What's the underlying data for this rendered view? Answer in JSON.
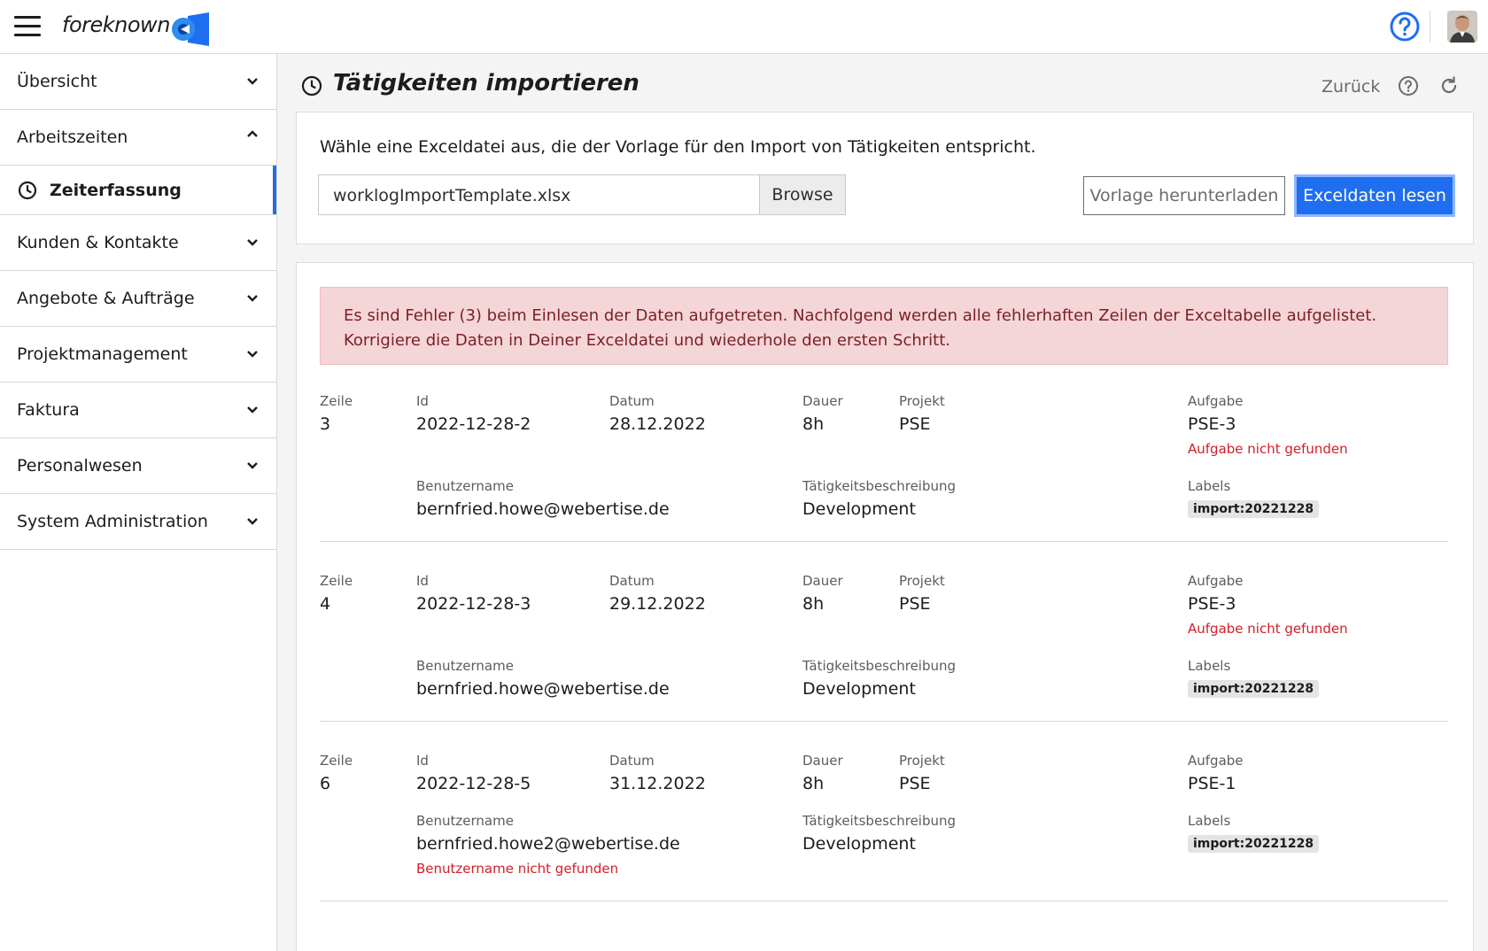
{
  "app": {
    "logo_text": "foreknown"
  },
  "sidebar": {
    "items": [
      {
        "label": "Übersicht",
        "expanded": false
      },
      {
        "label": "Arbeitszeiten",
        "expanded": true
      },
      {
        "label": "Kunden & Kontakte",
        "expanded": false
      },
      {
        "label": "Angebote & Aufträge",
        "expanded": false
      },
      {
        "label": "Projektmanagement",
        "expanded": false
      },
      {
        "label": "Faktura",
        "expanded": false
      },
      {
        "label": "Personalwesen",
        "expanded": false
      },
      {
        "label": "System Administration",
        "expanded": false
      }
    ],
    "sub_item": {
      "label": "Zeiterfassung",
      "active": true
    }
  },
  "page": {
    "title": "Tätigkeiten importieren",
    "back_label": "Zurück"
  },
  "upload": {
    "hint": "Wähle eine Exceldatei aus, die der Vorlage für den Import von Tätigkeiten entspricht.",
    "file_name": "worklogImportTemplate.xlsx",
    "browse_label": "Browse",
    "download_label": "Vorlage herunterladen",
    "read_label": "Exceldaten lesen"
  },
  "results": {
    "alert": "Es sind Fehler (3) beim Einlesen der Daten aufgetreten. Nachfolgend werden alle fehlerhaften Zeilen der Exceltabelle aufgelistet. Korrigiere die Daten in Deiner Exceldatei und wiederhole den ersten Schritt.",
    "labels": {
      "zeile": "Zeile",
      "id": "Id",
      "datum": "Datum",
      "dauer": "Dauer",
      "projekt": "Projekt",
      "aufgabe": "Aufgabe",
      "benutzername": "Benutzername",
      "beschreibung": "Tätigkeitsbeschreibung",
      "labels": "Labels"
    },
    "rows": [
      {
        "zeile": "3",
        "id": "2022-12-28-2",
        "datum": "28.12.2022",
        "dauer": "8h",
        "projekt": "PSE",
        "aufgabe": "PSE-3",
        "aufgabe_error": "Aufgabe nicht gefunden",
        "benutzername": "bernfried.howe@webertise.de",
        "benutzername_error": "",
        "beschreibung": "Development",
        "label": "import:20221228"
      },
      {
        "zeile": "4",
        "id": "2022-12-28-3",
        "datum": "29.12.2022",
        "dauer": "8h",
        "projekt": "PSE",
        "aufgabe": "PSE-3",
        "aufgabe_error": "Aufgabe nicht gefunden",
        "benutzername": "bernfried.howe@webertise.de",
        "benutzername_error": "",
        "beschreibung": "Development",
        "label": "import:20221228"
      },
      {
        "zeile": "6",
        "id": "2022-12-28-5",
        "datum": "31.12.2022",
        "dauer": "8h",
        "projekt": "PSE",
        "aufgabe": "PSE-1",
        "aufgabe_error": "",
        "benutzername": "bernfried.howe2@webertise.de",
        "benutzername_error": "Benutzername nicht gefunden",
        "beschreibung": "Development",
        "label": "import:20221228"
      }
    ]
  },
  "colors": {
    "accent": "#1f6ef0",
    "error": "#d0202a",
    "alert_bg": "#f5d6d8"
  }
}
